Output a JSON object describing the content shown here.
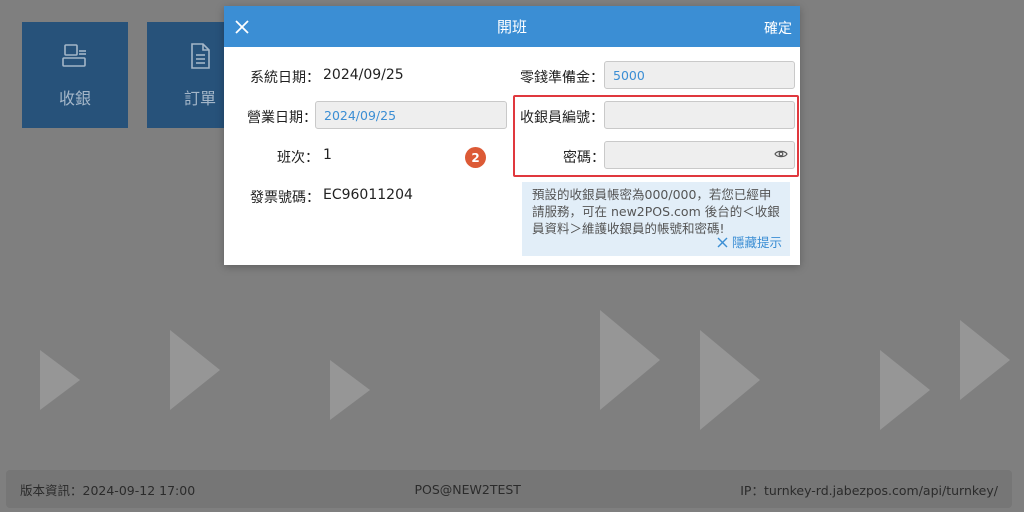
{
  "background": {
    "tiles": [
      {
        "label": "收銀",
        "icon": "cashier-icon"
      },
      {
        "label": "訂單",
        "icon": "document-icon"
      }
    ],
    "footer": {
      "version": "版本資訊：2024-09-12 17:00",
      "device": "POS@NEW2TEST",
      "ip": "IP：turnkey-rd.jabezpos.com/api/turnkey/"
    }
  },
  "dialog": {
    "title": "開班",
    "confirm_label": "確定",
    "close_icon": "close-icon",
    "left": {
      "system_date_label": "系統日期：",
      "system_date_value": "2024/09/25",
      "business_date_label": "營業日期：",
      "business_date_value": "2024/09/25",
      "shift_label": "班次：",
      "shift_value": "1",
      "invoice_label": "發票號碼：",
      "invoice_value": "EC96011204"
    },
    "right": {
      "petty_cash_label": "零錢準備金：",
      "petty_cash_value": "5000",
      "cashier_id_label": "收銀員編號：",
      "cashier_id_value": "",
      "password_label": "密碼：",
      "password_value": ""
    },
    "step_badge": "2",
    "hint": {
      "text": "預設的收銀員帳密為000/000，若您已經申請服務，可在 new2POS.com 後台的＜收銀員資料＞維護收銀員的帳號和密碼!",
      "hide_label": "隱藏提示"
    }
  },
  "colors": {
    "header_blue": "#3b8ed4",
    "highlight_red": "#e0383e",
    "badge_orange": "#dc5a36",
    "hint_bg": "#e2eef8"
  }
}
